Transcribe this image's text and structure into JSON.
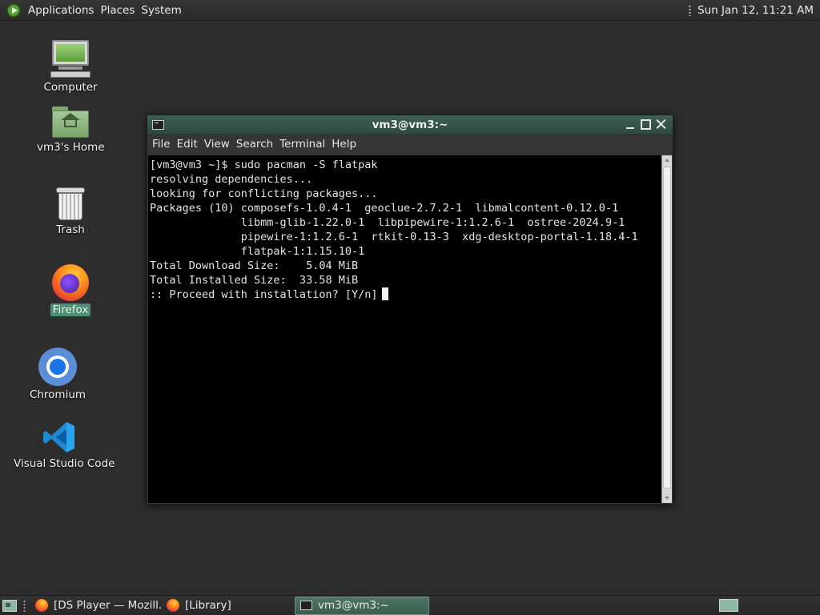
{
  "top_panel": {
    "menus": [
      "Applications",
      "Places",
      "System"
    ],
    "clock": "Sun Jan 12, 11:21 AM"
  },
  "desktop": {
    "icons": [
      {
        "label": "Computer",
        "icon": "computer-icon"
      },
      {
        "label": "vm3's Home",
        "icon": "home-folder-icon"
      },
      {
        "label": "Trash",
        "icon": "trash-icon"
      },
      {
        "label": "Firefox",
        "icon": "firefox-icon",
        "selected": true
      },
      {
        "label": "Chromium",
        "icon": "chromium-icon"
      },
      {
        "label": "Visual Studio Code",
        "icon": "vscode-icon"
      }
    ]
  },
  "terminal_window": {
    "title": "vm3@vm3:~",
    "menu": [
      "File",
      "Edit",
      "View",
      "Search",
      "Terminal",
      "Help"
    ],
    "lines": [
      "[vm3@vm3 ~]$ sudo pacman -S flatpak",
      "resolving dependencies...",
      "looking for conflicting packages...",
      "",
      "Packages (10) composefs-1.0.4-1  geoclue-2.7.2-1  libmalcontent-0.12.0-1",
      "              libmm-glib-1.22.0-1  libpipewire-1:1.2.6-1  ostree-2024.9-1",
      "              pipewire-1:1.2.6-1  rtkit-0.13-3  xdg-desktop-portal-1.18.4-1",
      "              flatpak-1:1.15.10-1",
      "",
      "Total Download Size:    5.04 MiB",
      "Total Installed Size:  33.58 MiB",
      "",
      ":: Proceed with installation? [Y/n]"
    ]
  },
  "taskbar": {
    "tasks": [
      {
        "label": "[DS Player — Mozill...",
        "icon": "firefox-icon",
        "active": false
      },
      {
        "label": "[Library]",
        "icon": "firefox-icon",
        "active": false
      },
      {
        "label": "vm3@vm3:~",
        "icon": "terminal-icon",
        "active": true
      }
    ]
  },
  "colors": {
    "accent": "#3c5d50",
    "desktop_bg": "#2d2d2d",
    "terminal_bg": "#000000"
  }
}
